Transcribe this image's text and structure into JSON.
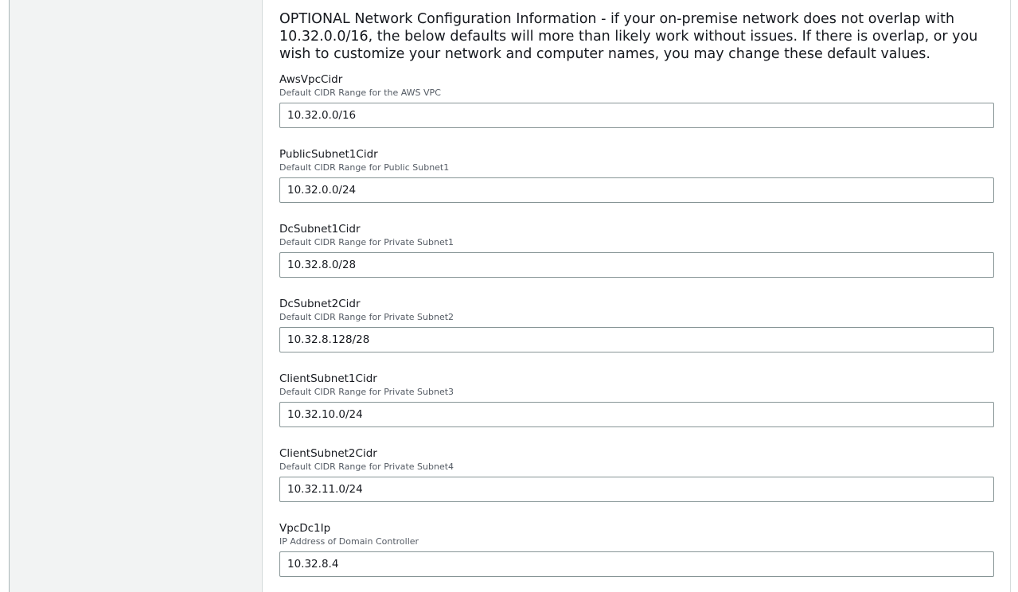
{
  "section": {
    "heading": "OPTIONAL Network Configuration Information - if your on-premise network does not overlap with 10.32.0.0/16, the below defaults will more than likely work without issues. If there is overlap, or you wish to customize your network and computer names, you may change these default values."
  },
  "fields": [
    {
      "label": "AwsVpcCidr",
      "description": "Default CIDR Range for the AWS VPC",
      "value": "10.32.0.0/16"
    },
    {
      "label": "PublicSubnet1Cidr",
      "description": "Default CIDR Range for Public Subnet1",
      "value": "10.32.0.0/24"
    },
    {
      "label": "DcSubnet1Cidr",
      "description": "Default CIDR Range for Private Subnet1",
      "value": "10.32.8.0/28"
    },
    {
      "label": "DcSubnet2Cidr",
      "description": "Default CIDR Range for Private Subnet2",
      "value": "10.32.8.128/28"
    },
    {
      "label": "ClientSubnet1Cidr",
      "description": "Default CIDR Range for Private Subnet3",
      "value": "10.32.10.0/24"
    },
    {
      "label": "ClientSubnet2Cidr",
      "description": "Default CIDR Range for Private Subnet4",
      "value": "10.32.11.0/24"
    },
    {
      "label": "VpcDc1Ip",
      "description": "IP Address of Domain Controller",
      "value": "10.32.8.4"
    }
  ]
}
